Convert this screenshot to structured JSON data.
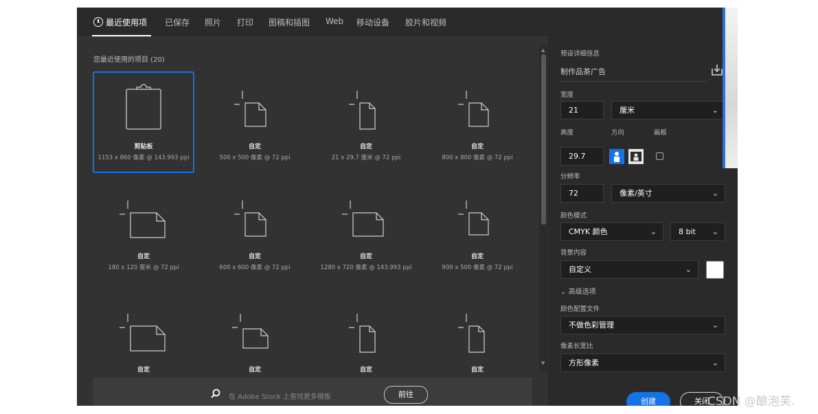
{
  "tabs": {
    "recent": "最近使用项",
    "saved": "已保存",
    "photo": "照片",
    "print": "打印",
    "art": "图稿和插图",
    "web": "Web",
    "mobile": "移动设备",
    "film": "胶片和视频"
  },
  "recent": {
    "title": "您最近使用的项目 (20)",
    "items": [
      {
        "name": "剪贴板",
        "size": "1153 x 860 像素 @ 143.993 ppi"
      },
      {
        "name": "自定",
        "size": "500 x 500 像素 @ 72 ppi"
      },
      {
        "name": "自定",
        "size": "21 x 29.7 厘米 @ 72 ppi"
      },
      {
        "name": "自定",
        "size": "800 x 800 像素 @ 72 ppi"
      },
      {
        "name": "自定",
        "size": "180 x 120 厘米 @ 72 ppi"
      },
      {
        "name": "自定",
        "size": "600 x 600 像素 @ 72 ppi"
      },
      {
        "name": "自定",
        "size": "1280 x 720 像素 @ 143.993 ppi"
      },
      {
        "name": "自定",
        "size": "900 x 500 像素 @ 72 ppi"
      },
      {
        "name": "自定",
        "size": ""
      },
      {
        "name": "自定",
        "size": ""
      },
      {
        "name": "自定",
        "size": ""
      },
      {
        "name": "自定",
        "size": ""
      }
    ]
  },
  "stock": {
    "placeholder": "在 Adobe Stock 上查找更多模板",
    "go": "前往"
  },
  "preset": {
    "title": "预设详细信息",
    "name": "制作品茶广告",
    "width_label": "宽度",
    "width": "21",
    "width_unit": "厘米",
    "height_label": "高度",
    "height": "29.7",
    "orientation_label": "方向",
    "artboard_label": "画板",
    "resolution_label": "分辨率",
    "resolution": "72",
    "resolution_unit": "像素/英寸",
    "color_mode_label": "颜色模式",
    "color_mode": "CMYK 颜色",
    "bit_depth": "8 bit",
    "background_label": "背景内容",
    "background": "自定义",
    "background_color": "#ffffff",
    "advanced": "高级选项",
    "color_profile_label": "颜色配置文件",
    "color_profile": "不做色彩管理",
    "aspect_label": "像素长宽比",
    "aspect": "方形像素",
    "create": "创建",
    "close": "关闭"
  },
  "watermark": "CSDN @酿泡芙."
}
